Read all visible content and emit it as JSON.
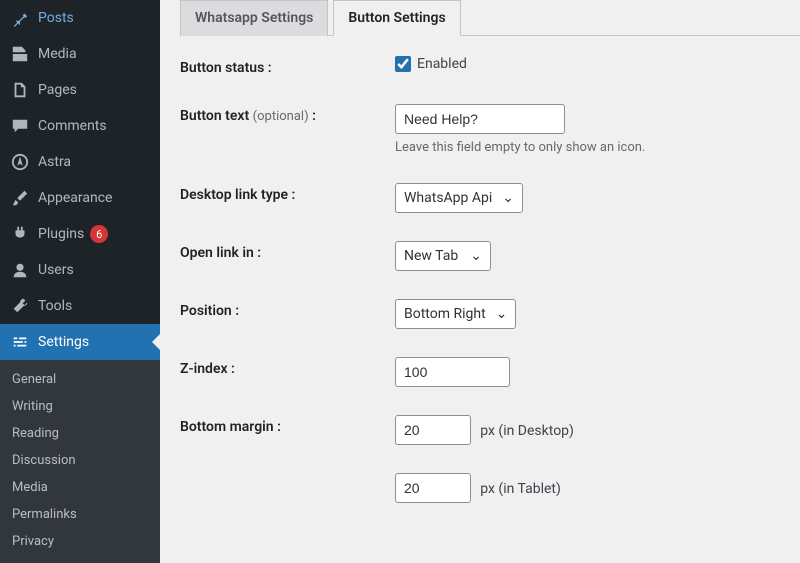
{
  "sidebar": {
    "items": [
      {
        "label": "Posts"
      },
      {
        "label": "Media"
      },
      {
        "label": "Pages"
      },
      {
        "label": "Comments"
      },
      {
        "label": "Astra"
      },
      {
        "label": "Appearance"
      },
      {
        "label": "Plugins",
        "badge": "6"
      },
      {
        "label": "Users"
      },
      {
        "label": "Tools"
      },
      {
        "label": "Settings"
      }
    ],
    "submenu": [
      {
        "label": "General"
      },
      {
        "label": "Writing"
      },
      {
        "label": "Reading"
      },
      {
        "label": "Discussion"
      },
      {
        "label": "Media"
      },
      {
        "label": "Permalinks"
      },
      {
        "label": "Privacy"
      }
    ]
  },
  "tabs": {
    "whatsapp": "Whatsapp Settings",
    "button": "Button Settings"
  },
  "form": {
    "button_status_label": "Button status :",
    "button_status_checkbox": "Enabled",
    "button_text_label": "Button text",
    "optional": "(optional)",
    "button_text_value": "Need Help?",
    "button_text_help": "Leave this field empty to only show an icon.",
    "desktop_link_label": "Desktop link type :",
    "desktop_link_value": "WhatsApp Api",
    "open_link_label": "Open link in :",
    "open_link_value": "New Tab",
    "position_label": "Position :",
    "position_value": "Bottom Right",
    "zindex_label": "Z-index :",
    "zindex_value": "100",
    "bottom_margin_label": "Bottom margin :",
    "bottom_margin_desktop": "20",
    "bottom_margin_desktop_suffix": "px (in Desktop)",
    "bottom_margin_tablet": "20",
    "bottom_margin_tablet_suffix": "px (in Tablet)",
    "colon": " :"
  }
}
